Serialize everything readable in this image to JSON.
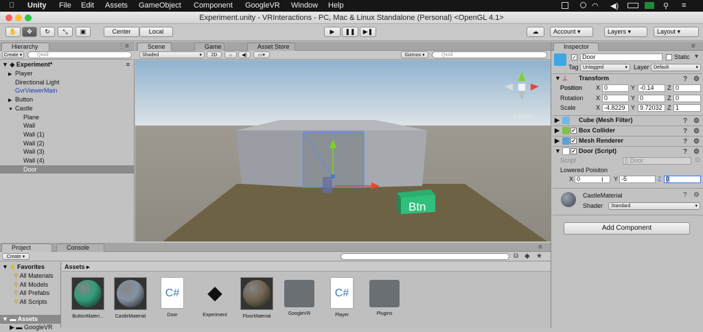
{
  "menubar": {
    "apple": "",
    "app": "Unity",
    "items": [
      "File",
      "Edit",
      "Assets",
      "GameObject",
      "Component",
      "GoogleVR",
      "Window",
      "Help"
    ]
  },
  "window": {
    "title": "Experiment.unity - VRInteractions - PC, Mac & Linux Standalone (Personal) <OpenGL 4.1>"
  },
  "toolbar": {
    "pivot": "Center",
    "space": "Local",
    "account": "Account",
    "layers": "Layers",
    "layout": "Layout"
  },
  "hierarchy": {
    "tab": "Hierarchy",
    "create": "Create",
    "search": "Q▾All",
    "scene": "Experiment*",
    "items": [
      {
        "label": "Player",
        "indent": 1,
        "arrow": "▶"
      },
      {
        "label": "Directional Light",
        "indent": 1,
        "arrow": ""
      },
      {
        "label": "GvrViewerMain",
        "indent": 1,
        "arrow": "",
        "blue": true
      },
      {
        "label": "Button",
        "indent": 1,
        "arrow": "▶"
      },
      {
        "label": "Castle",
        "indent": 1,
        "arrow": "▼"
      },
      {
        "label": "Plane",
        "indent": 2,
        "arrow": ""
      },
      {
        "label": "Wall",
        "indent": 2,
        "arrow": ""
      },
      {
        "label": "Wall (1)",
        "indent": 2,
        "arrow": ""
      },
      {
        "label": "Wall (2)",
        "indent": 2,
        "arrow": ""
      },
      {
        "label": "Wall (3)",
        "indent": 2,
        "arrow": ""
      },
      {
        "label": "Wall (4)",
        "indent": 2,
        "arrow": ""
      },
      {
        "label": "Door",
        "indent": 2,
        "arrow": "",
        "selected": true
      }
    ]
  },
  "scene": {
    "tab_scene": "Scene",
    "tab_game": "Game",
    "tab_store": "Asset Store",
    "shading": "Shaded",
    "mode2d": "2D",
    "gizmos": "Gizmos",
    "search": "Q▾All",
    "persp": "< Persp",
    "button_text": "Btn"
  },
  "inspector": {
    "tab": "Inspector",
    "name": "Door",
    "static_label": "Static",
    "tag_label": "Tag",
    "tag": "Untagged",
    "layer_label": "Layer",
    "layer": "Default",
    "transform": {
      "title": "Transform",
      "position": {
        "label": "Position",
        "x": "0",
        "y": "-0.14",
        "z": "0"
      },
      "rotation": {
        "label": "Rotation",
        "x": "0",
        "y": "0",
        "z": "0"
      },
      "scale": {
        "label": "Scale",
        "x": "-4.8229",
        "y": "9.72032",
        "z": "1"
      }
    },
    "components": [
      "Cube (Mesh Filter)",
      "Box Collider",
      "Mesh Renderer",
      "Door (Script)"
    ],
    "script_label": "Script",
    "script_value": "Door",
    "lowered_label": "Lowered Poisiton",
    "lowered": {
      "x": "0",
      "y": "-5",
      "z": "0"
    },
    "material": "CastleMaterial",
    "shader_label": "Shader",
    "shader": "Standard",
    "add_component": "Add Component"
  },
  "project": {
    "tab_project": "Project",
    "tab_console": "Console",
    "create": "Create",
    "favorites": "Favorites",
    "fav_items": [
      "All Materials",
      "All Models",
      "All Prefabs",
      "All Scripts"
    ],
    "assets_root": "Assets",
    "assets_child": "GoogleVR",
    "breadcrumb": "Assets ▸",
    "assets": [
      {
        "label": "ButtonMateri...",
        "kind": "sphere",
        "color": "#2f9e7a"
      },
      {
        "label": "CastleMaterial",
        "kind": "sphere",
        "color": "#8592a3"
      },
      {
        "label": "Door",
        "kind": "script"
      },
      {
        "label": "Experiment",
        "kind": "unity"
      },
      {
        "label": "FloorMaterial",
        "kind": "sphere",
        "color": "#6f6450"
      },
      {
        "label": "GoogleVR",
        "kind": "folder"
      },
      {
        "label": "Player",
        "kind": "script"
      },
      {
        "label": "Plugins",
        "kind": "folder"
      }
    ]
  },
  "colors": {
    "selected": "#8a8a8a",
    "accent": "#3d7ad8",
    "sky_top": "#8fb3cf",
    "ground": "#6e6245"
  }
}
